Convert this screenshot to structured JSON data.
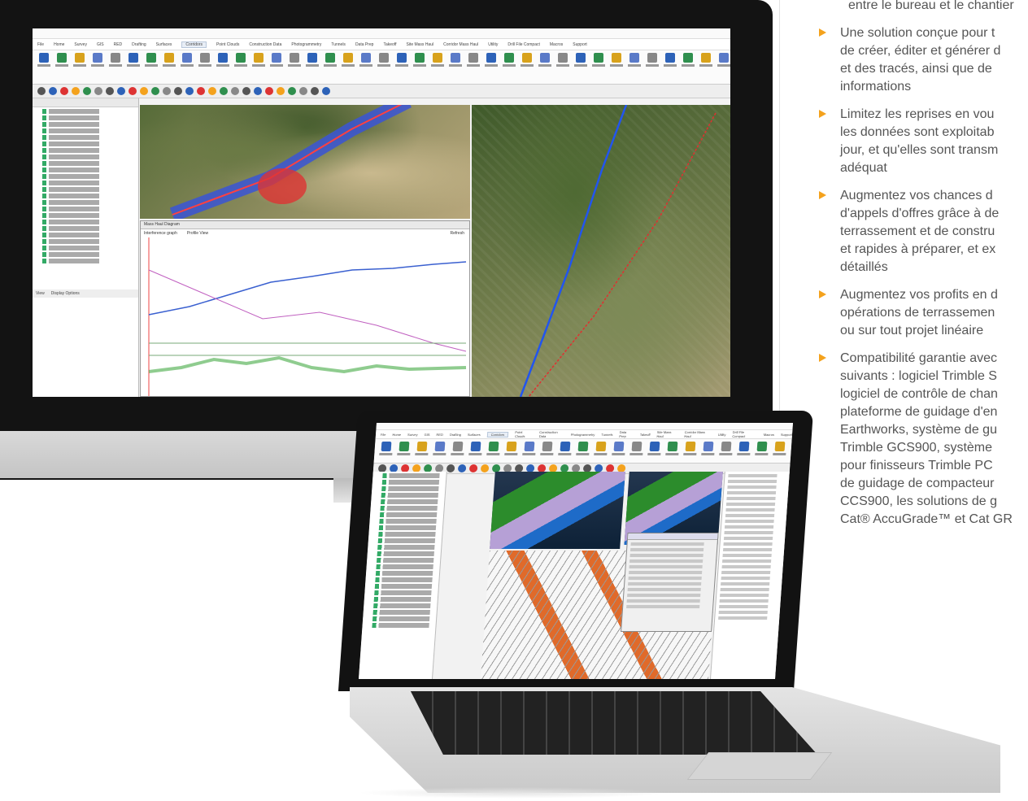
{
  "right_column": {
    "top_line": "entre le bureau et le chantier",
    "bullets": [
      "Une solution conçue pour t\nde créer, éditer et générer d\net des tracés, ainsi que de\ninformations",
      "Limitez les reprises en vou\nles données sont exploitab\njour, et qu'elles sont transm\nadéquat",
      "Augmentez vos chances d\nd'appels d'offres grâce à de\nterrassement et de constru\net rapides à préparer, et ex\ndétaillés",
      "Augmentez vos profits en d\nopérations de terrassemen\nou sur tout projet linéaire",
      "Compatibilité garantie avec\nsuivants : logiciel Trimble S\nlogiciel de contrôle de chan\nplateforme de guidage d'en\nEarthworks, système de gu\nTrimble GCS900, système\npour finisseurs Trimble PC\nde guidage de compacteur\nCCS900, les solutions de g\nCat® AccuGrade™ et Cat GR"
    ]
  },
  "monitor_app": {
    "menu": [
      "File",
      "Home",
      "Survey",
      "GIS",
      "RED",
      "Drafting",
      "Surfaces",
      "Corridors",
      "Point Clouds",
      "Construction Data",
      "Photogrammetry",
      "Tunnels",
      "Data Prep",
      "Takeoff",
      "Site Mass Haul",
      "Corridor Mass Haul",
      "Utility",
      "Drill File Compact",
      "Macros",
      "Support"
    ],
    "active_tab": "Corridors",
    "profile_panel": {
      "title": "Mass Haul Diagram",
      "option_a": "Interference graph",
      "option_b": "Profile View",
      "refresh": "Refresh"
    },
    "left_panel": {
      "tab_view": "View",
      "tab_display": "Display Options"
    }
  },
  "colors": {
    "accent": "#f4a21d",
    "text": "#555555",
    "screen_bezel": "#131313"
  },
  "icons": [
    "arrow-bullet-icon",
    "apple-logo-icon",
    "help-icon"
  ]
}
